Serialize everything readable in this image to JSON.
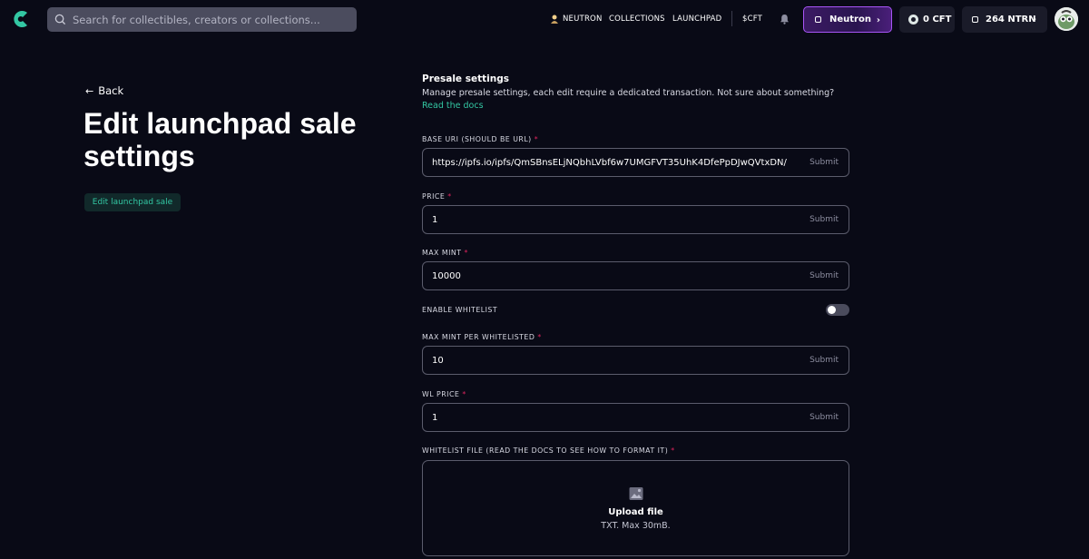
{
  "header": {
    "search_placeholder": "Search for collectibles, creators or collections...",
    "nav": {
      "neutron": "NEUTRON",
      "collections": "COLLECTIONS",
      "launchpad": "LAUNCHPAD",
      "cft": "$CFT"
    },
    "network_button": "Neutron",
    "cft_balance": "0 CFT",
    "ntrn_balance": "264 NTRN"
  },
  "left": {
    "back_label": "Back",
    "title": "Edit launchpad sale settings",
    "tab_label": "Edit launchpad sale"
  },
  "presale": {
    "title": "Presale settings",
    "description": "Manage presale settings, each edit require a dedicated transaction. Not sure about something?",
    "docs_link": "Read the docs",
    "required_marker": "*",
    "submit_label": "Submit",
    "fields": {
      "base_uri": {
        "label": "BASE URI (SHOULD BE URL)",
        "value": "https://ipfs.io/ipfs/QmSBnsELjNQbhLVbf6w7UMGFVT35UhK4DfePpDJwQVtxDN/"
      },
      "price": {
        "label": "PRICE",
        "value": "1"
      },
      "max_mint": {
        "label": "MAX MINT",
        "value": "10000"
      },
      "max_mint_per_whitelisted": {
        "label": "MAX MINT PER WHITELISTED",
        "value": "10"
      },
      "wl_price": {
        "label": "WL PRICE",
        "value": "1"
      }
    },
    "enable_whitelist": {
      "label": "ENABLE WHITELIST",
      "enabled": false
    },
    "whitelist_file": {
      "label": "WHITELIST FILE (READ THE DOCS TO SEE HOW TO FORMAT IT)",
      "upload_title": "Upload file",
      "upload_hint": "TXT. Max 30mB."
    }
  },
  "colors": {
    "background": "#090a16",
    "accent": "#33c7a3",
    "required": "#e0245e",
    "network_border": "#a855f7"
  }
}
